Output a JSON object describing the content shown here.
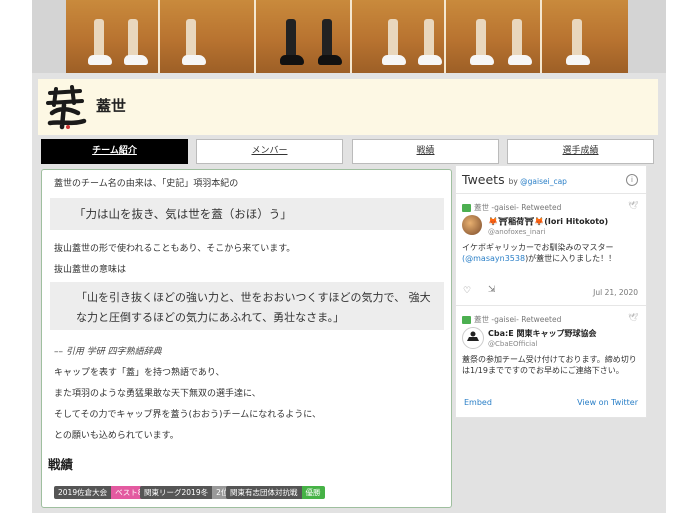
{
  "header": {
    "team_name": "蓋世",
    "logo_alt": "蓋世"
  },
  "tabs": [
    {
      "label": "チーム紹介",
      "active": true
    },
    {
      "label": "メンバー",
      "active": false
    },
    {
      "label": "戦績",
      "active": false
    },
    {
      "label": "選手成績",
      "active": false
    }
  ],
  "main": {
    "intro": "蓋世のチーム名の由来は、「史記」項羽本紀の",
    "quote1": "「力は山を抜き、気は世を蓋（おほ）う」",
    "line1": "抜山蓋世の形で使われることもあり、そこから来ています。",
    "line2": "抜山蓋世の意味は",
    "quote2": "「山を引き抜くほどの強い力と、世をおおいつくすほどの気力で、 強大な力と圧倒するほどの気力にあふれて、勇壮なさま。」",
    "cite": "–– 引用  学研  四字熟語辞典",
    "line3": "キャップを表す「蓋」を持つ熟語であり、",
    "line4": "また項羽のような勇猛果敢な天下無双の選手達に、",
    "line5": "そしてその力でキャップ界を蓋う(おおう)チームになれるように、",
    "line6": "との願いも込められています。",
    "results_title": "戦績",
    "badges": [
      {
        "event": "2019佐倉大会",
        "result": "ベスト8",
        "color": "#e35aa0"
      },
      {
        "event": "関東リーグ2019冬",
        "result": "2位",
        "color": "#999999"
      },
      {
        "event": "関東有志団体対抗戦",
        "result": "優勝",
        "color": "#46b246"
      }
    ]
  },
  "twitter": {
    "title": "Tweets",
    "by": "by",
    "handle": "@gaisei_cap",
    "tweets": [
      {
        "retweet_label": "蓋世 -gaisei- Retweeted",
        "name": "🦊⛩稲荷⛩🦊(Iori Hitokoto)",
        "user": "@anofoxes_inari",
        "text_before": "イケボギャリッカーでお馴染みのマスター",
        "mention": "(@masayn3538",
        "text_after": ")が蓋世に入りました！！",
        "date": "Jul 21, 2020"
      },
      {
        "retweet_label": "蓋世 -gaisei- Retweeted",
        "name": "Cba:E 関東キャップ野球協会",
        "user": "@CbaEOfficial",
        "text": "蓋祭の参加チーム受け付けております。締め切りは1/19までですのでお早めにご連絡下さい。"
      }
    ],
    "embed": "Embed",
    "view": "View on Twitter"
  }
}
